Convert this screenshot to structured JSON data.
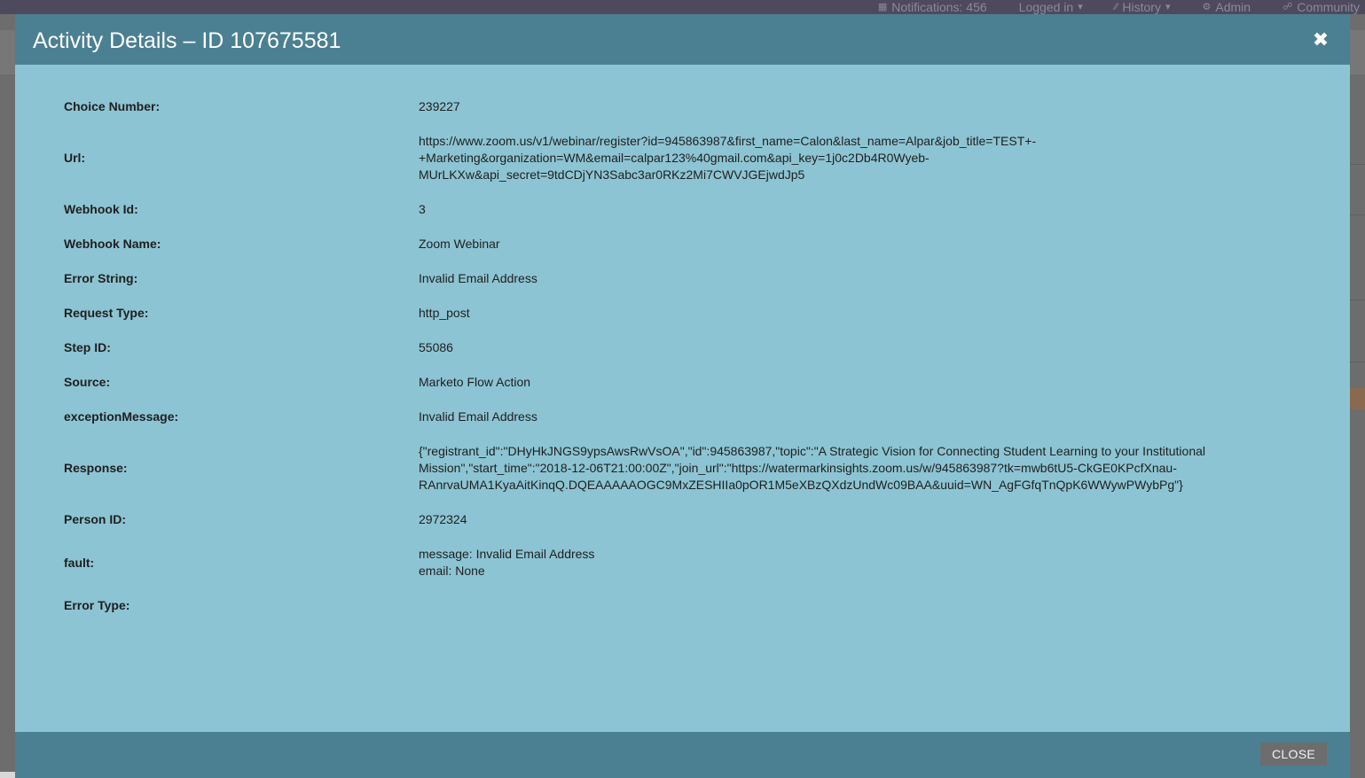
{
  "topnav": {
    "notifications": "Notifications: 456",
    "logged_in": "Logged in",
    "history": "History",
    "admin": "Admin",
    "community": "Community"
  },
  "modal": {
    "title": "Activity Details – ID 107675581",
    "close_label": "CLOSE",
    "fields": [
      {
        "label": "Choice Number:",
        "value": "239227"
      },
      {
        "label": "Url:",
        "value": "https://www.zoom.us/v1/webinar/register?id=945863987&first_name=Calon&last_name=Alpar&job_title=TEST+-\n+Marketing&organization=WM&email=calpar123%40gmail.com&api_key=1j0c2Db4R0Wyeb-\nMUrLKXw&api_secret=9tdCDjYN3Sabc3ar0RKz2Mi7CWVJGEjwdJp5"
      },
      {
        "label": "Webhook Id:",
        "value": "3"
      },
      {
        "label": "Webhook Name:",
        "value": "Zoom Webinar"
      },
      {
        "label": "Error String:",
        "value": "Invalid Email Address"
      },
      {
        "label": "Request Type:",
        "value": "http_post"
      },
      {
        "label": "Step ID:",
        "value": "55086"
      },
      {
        "label": "Source:",
        "value": "Marketo Flow Action"
      },
      {
        "label": "exceptionMessage:",
        "value": "Invalid Email Address"
      },
      {
        "label": "Response:",
        "value": "{\"registrant_id\":\"DHyHkJNGS9ypsAwsRwVsOA\",\"id\":945863987,\"topic\":\"A Strategic Vision for Connecting Student Learning to your Institutional\nMission\",\"start_time\":\"2018-12-06T21:00:00Z\",\"join_url\":\"https://watermarkinsights.zoom.us/w/945863987?tk=mwb6tU5-CkGE0KPcfXnau-\nRAnrvaUMA1KyaAitKinqQ.DQEAAAAAOGC9MxZESHIIa0pOR1M5eXBzQXdzUndWc09BAA&uuid=WN_AgFGfqTnQpK6WWywPWybPg\"}"
      },
      {
        "label": "Person ID:",
        "value": "2972324"
      },
      {
        "label": "fault:",
        "value": "message: Invalid Email Address\nemail: None"
      },
      {
        "label": "Error Type:",
        "value": ""
      }
    ]
  },
  "colors": {
    "header": "#4b8092",
    "body": "#8cc4d3",
    "close_button": "#6d6d6d"
  }
}
